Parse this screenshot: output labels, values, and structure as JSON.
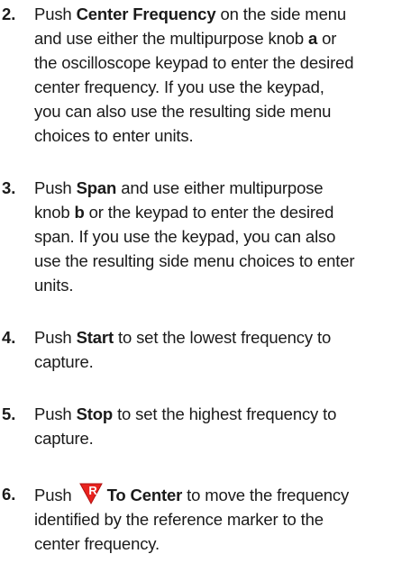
{
  "steps": [
    {
      "number": "2.",
      "lines": [
        [
          "Push ",
          {
            "bold": "Center Frequency"
          },
          " on the side menu"
        ],
        [
          "and use either the multipurpose knob ",
          {
            "bold": "a"
          },
          " or"
        ],
        [
          "the oscilloscope keypad to enter the desired"
        ],
        [
          "center frequency.  If you use the keypad,"
        ],
        [
          "you can also use the resulting side menu"
        ],
        [
          "choices to enter units."
        ]
      ]
    },
    {
      "number": "3.",
      "lines": [
        [
          "Push ",
          {
            "bold": "Span"
          },
          " and use either multipurpose"
        ],
        [
          "knob ",
          {
            "bold": "b"
          },
          " or the keypad to enter the desired"
        ],
        [
          "span.  If you use the keypad, you can also"
        ],
        [
          "use the resulting side menu choices to enter"
        ],
        [
          "units."
        ]
      ]
    },
    {
      "number": "4.",
      "lines": [
        [
          "Push ",
          {
            "bold": "Start"
          },
          " to set the lowest frequency to"
        ],
        [
          "capture."
        ]
      ]
    },
    {
      "number": "5.",
      "lines": [
        [
          "Push ",
          {
            "bold": "Stop"
          },
          " to set the highest frequency to"
        ],
        [
          "capture."
        ]
      ]
    },
    {
      "number": "6.",
      "lines": [
        [
          "Push ",
          {
            "icon": "reference-marker-icon"
          },
          {
            "bold": "To Center"
          },
          " to move the frequency"
        ],
        [
          "identified by the reference marker to the"
        ],
        [
          "center frequency."
        ]
      ]
    }
  ],
  "icon": {
    "name": "reference-marker-icon",
    "letter": "R",
    "fill_color": "#e8231f",
    "stroke_color": "#ffffff"
  }
}
